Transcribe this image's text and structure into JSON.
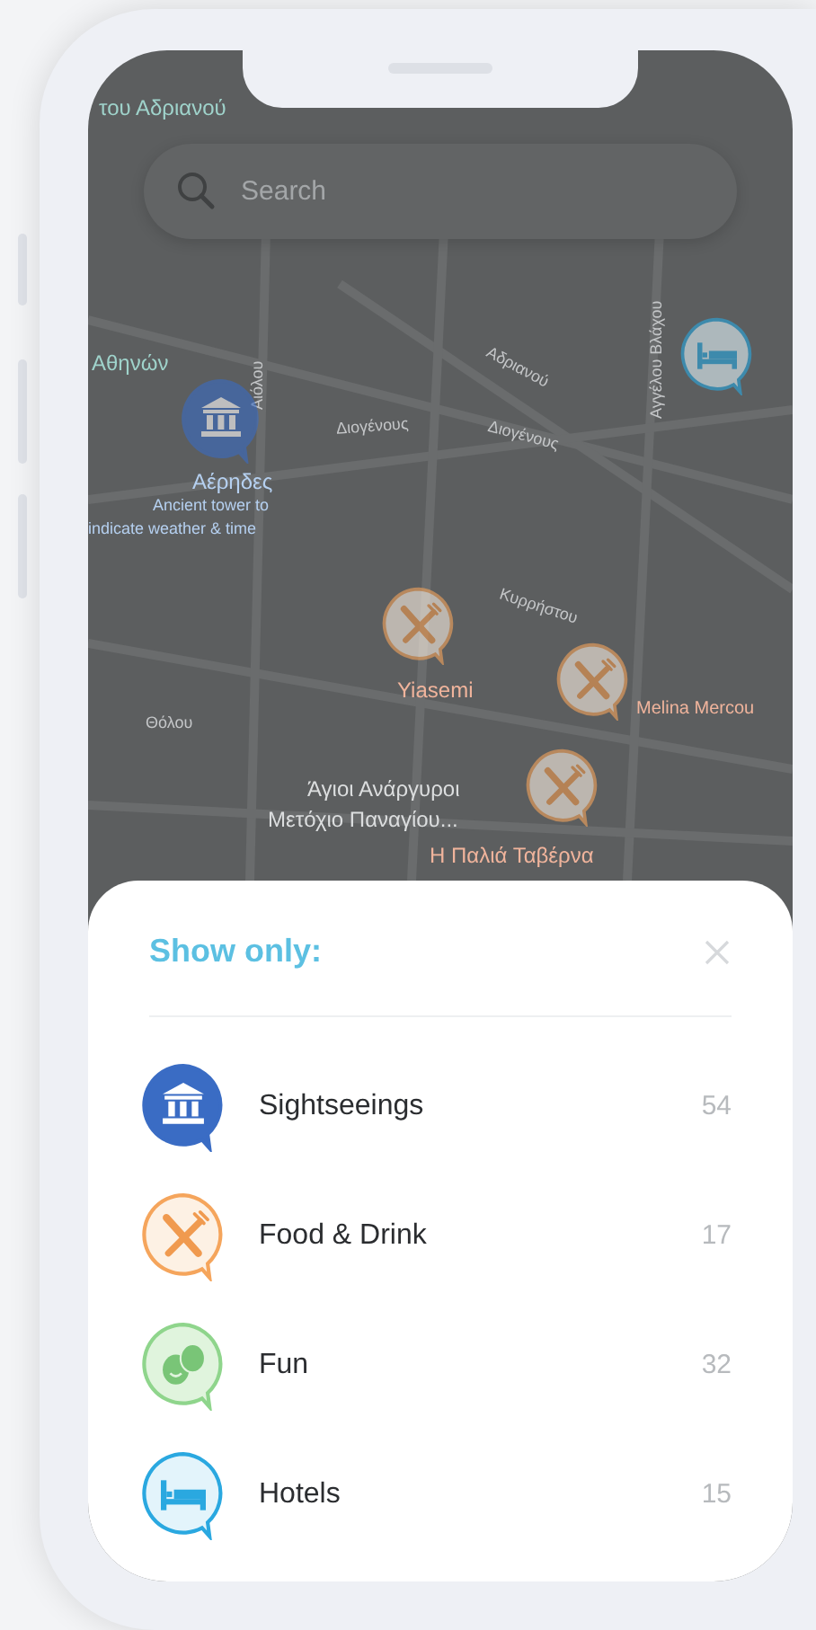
{
  "search": {
    "placeholder": "Search"
  },
  "map": {
    "labels": [
      {
        "text": "του Αδριανού",
        "kind": "place"
      },
      {
        "text": "Αθηνών",
        "kind": "place"
      },
      {
        "text": "Αιόλου",
        "kind": "street"
      },
      {
        "text": "Αδριανού",
        "kind": "street"
      },
      {
        "text": "Αγγέλου Βλάχου",
        "kind": "street"
      },
      {
        "text": "Διογένους",
        "kind": "street"
      },
      {
        "text": "Διογένους",
        "kind": "street"
      },
      {
        "text": "Αέρηδες",
        "kind": "sight"
      },
      {
        "text": "Ancient tower to",
        "kind": "note"
      },
      {
        "text": "indicate weather & time",
        "kind": "note"
      },
      {
        "text": "Κυρρήστου",
        "kind": "street"
      },
      {
        "text": "Θόλου",
        "kind": "street"
      },
      {
        "text": "Yiasemi",
        "kind": "food"
      },
      {
        "text": "Melina Mercou",
        "kind": "food"
      },
      {
        "text": "Άγιοι Ανάργυροι",
        "kind": "poi"
      },
      {
        "text": "Μετόχιο Παναγίου...",
        "kind": "poi"
      },
      {
        "text": "Η Παλιά Ταβέρνα",
        "kind": "food"
      }
    ]
  },
  "sheet": {
    "title": "Show only:",
    "categories": [
      {
        "kind": "sight",
        "label": "Sightseeings",
        "count": "54"
      },
      {
        "kind": "food",
        "label": "Food & Drink",
        "count": "17"
      },
      {
        "kind": "fun",
        "label": "Fun",
        "count": "32"
      },
      {
        "kind": "hotel",
        "label": "Hotels",
        "count": "15"
      }
    ]
  }
}
